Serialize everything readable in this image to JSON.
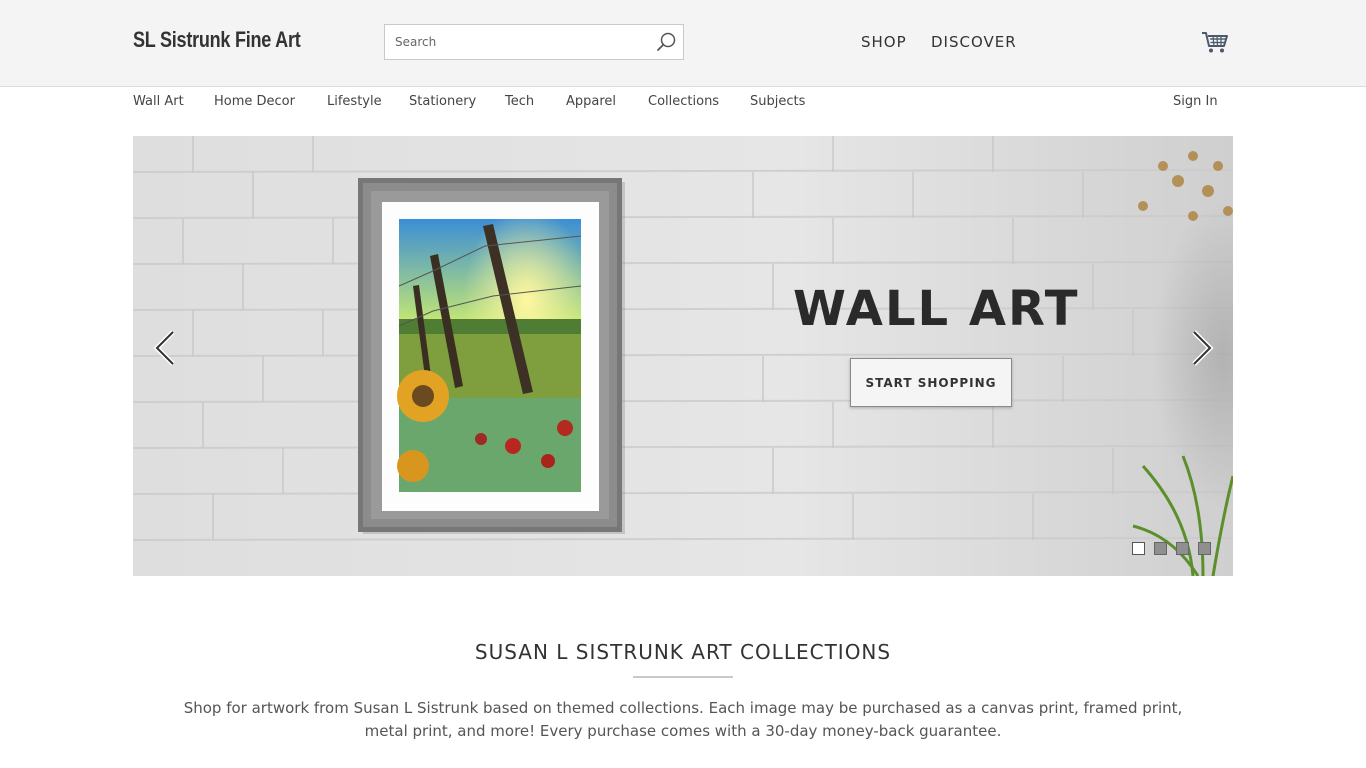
{
  "header": {
    "logo": "SL Sistrunk Fine Art",
    "search_placeholder": "Search",
    "nav": [
      "SHOP",
      "DISCOVER"
    ],
    "cart_icon": "cart-icon"
  },
  "subnav": {
    "items": [
      "Wall Art",
      "Home Decor",
      "Lifestyle",
      "Stationery",
      "Tech",
      "Apparel",
      "Collections",
      "Subjects"
    ],
    "sign_in": "Sign In"
  },
  "hero": {
    "title": "WALL ART",
    "button": "START SHOPPING",
    "prev_icon": "chevron-left-icon",
    "next_icon": "chevron-right-icon",
    "slides_count": 4,
    "active_slide": 1
  },
  "collections": {
    "title": "SUSAN L SISTRUNK ART COLLECTIONS",
    "description": "Shop for artwork from Susan L Sistrunk based on themed collections. Each image may be purchased as a canvas print, framed print, metal print, and more! Every purchase comes with a 30-day money-back guarantee."
  },
  "colors": {
    "header_bg": "#f4f4f4",
    "wall": "#e2e2e2",
    "text": "#333333"
  }
}
